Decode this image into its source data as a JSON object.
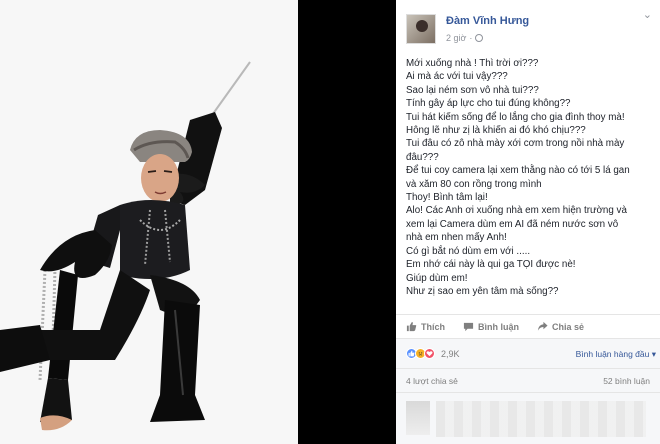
{
  "post": {
    "author": "Đàm Vĩnh Hưng",
    "time": "2 giờ",
    "more": "⌄",
    "lines": [
      "Mới xuống nhà ! Thì trời ơi???",
      "Ai mà ác với tui vậy???",
      "Sao lại ném sơn vô nhà tui???",
      "Tính gây áp lực cho tui đúng không??",
      "Tui hát kiếm sống để lo lắng cho gia đình thoy mà!",
      "Hông lẽ như zị là khiến ai đó khó chịu???",
      "Tui đâu có zô nhà mày xới cơm trong nồi nhà mày",
      "đâu???",
      "Để tui coy camera lại xem thằng nào có tới 5 lá gan",
      "và xăm 80 con rồng trong mình",
      "Thoy! Bình tâm lại!",
      "Alo! Các Anh ơi xuống nhà em xem hiện trường và",
      "xem lại Camera dùm em AI đã ném nước sơn vô",
      "nhà em nhen mấy Anh!",
      "Có gì bắt nó dùm em với .....",
      "Em nhớ cái này là qui ga TỌI được nè!",
      "Giúp dùm em!",
      "Như zị sao em yên tâm mà sống??"
    ]
  },
  "actions": {
    "like": "Thích",
    "comment": "Bình luận",
    "share": "Chia sẻ"
  },
  "reactions": {
    "count": "2,9K",
    "sort_label": "Bình luận hàng đầu",
    "icons": [
      "like-reaction",
      "sad-reaction",
      "love-reaction"
    ],
    "colors": {
      "like": "#5890ff",
      "sad": "#f7b125",
      "love": "#f25268"
    }
  },
  "counts": {
    "shares": "4 lượt chia sẻ",
    "comments": "52 bình luận"
  },
  "theme": {
    "link_color": "#365899",
    "text_color": "#1d2129",
    "muted_color": "#90949c"
  }
}
